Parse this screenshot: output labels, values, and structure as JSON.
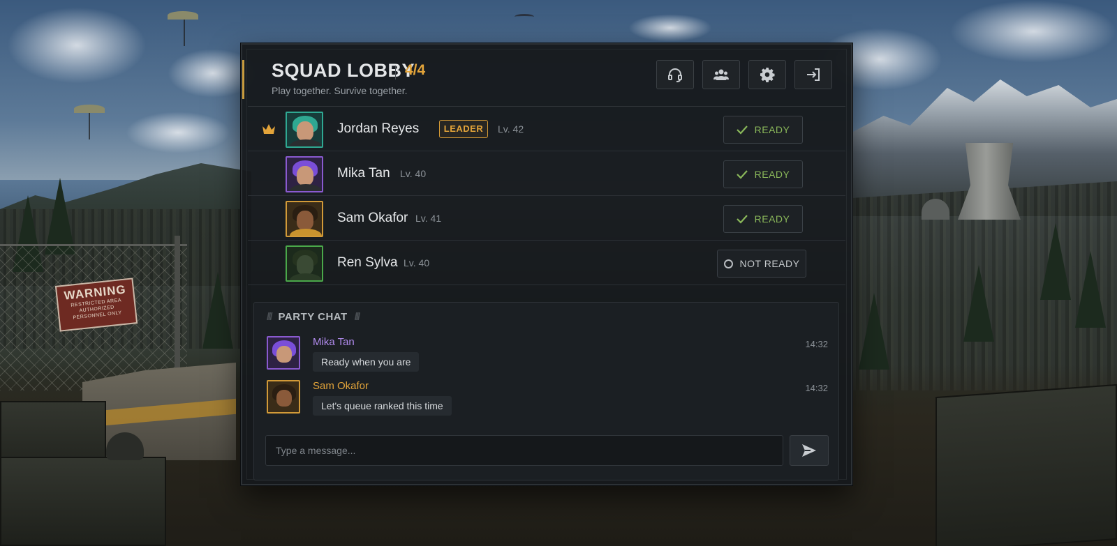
{
  "lobby": {
    "title": "SQUAD LOBBY",
    "count": "4/4",
    "subtitle": "Play together. Survive together.",
    "header_buttons": [
      {
        "icon": "headset-icon"
      },
      {
        "icon": "friends-icon"
      },
      {
        "icon": "gear-icon"
      },
      {
        "icon": "exit-icon"
      }
    ]
  },
  "players": [
    {
      "name": "Jordan Reyes",
      "badge": "LEADER",
      "level": "Lv. 42",
      "status": "READY",
      "ready": true,
      "avatar_color": "#2fa892"
    },
    {
      "name": "Mika Tan",
      "level": "Lv. 40",
      "status": "READY",
      "ready": true,
      "avatar_color": "#8a5ad0"
    },
    {
      "name": "Sam Okafor",
      "level": "Lv. 41",
      "status": "READY",
      "ready": true,
      "avatar_color": "#d29a38"
    },
    {
      "name": "Ren Sylva",
      "level": "Lv. 40",
      "status": "NOT READY",
      "ready": false,
      "avatar_color": "#4aa84a"
    }
  ],
  "chat": {
    "title": "PARTY CHAT",
    "messages": [
      {
        "sender": "Mika Tan",
        "text": "Ready when you are",
        "time": "14:32",
        "color": "#b38cf0"
      },
      {
        "sender": "Sam Okafor",
        "text": "Let's queue ranked this time",
        "time": "14:32",
        "color": "#e3a43a"
      }
    ],
    "input_placeholder": "Type a message..."
  },
  "scene": {
    "sign_title": "WARNING",
    "sign_lines": [
      "RESTRICTED AREA",
      "AUTHORIZED",
      "PERSONNEL ONLY"
    ]
  },
  "colors": {
    "accent": "#e3a43a",
    "ready": "#8ab85a"
  }
}
